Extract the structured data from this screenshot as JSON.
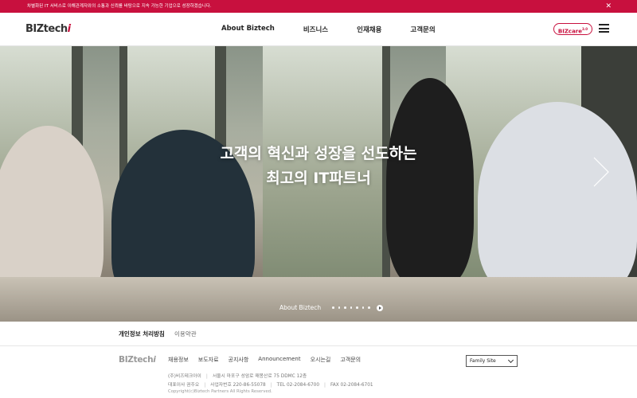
{
  "topbar": {
    "notice": "차별화된 IT 서비스로 이해관계자와의 소통과 신뢰를 바탕으로 지속 가능한 기업으로 성장하겠습니다.",
    "close_label": "✕"
  },
  "header": {
    "logo_text": "BIZtech",
    "logo_accent": "i",
    "nav": [
      "About Biztech",
      "비즈니스",
      "인재채용",
      "고객문의"
    ],
    "bizcare_label": "BIZcare",
    "bizcare_version": "3.0"
  },
  "hero": {
    "title_line1": "고객의 혁신과 성장을 선도하는",
    "title_line2": "최고의 IT파트너",
    "slide_label": "About Biztech",
    "dot_count": 7
  },
  "policy": {
    "privacy": "개인정보 처리방침",
    "terms": "이용약관"
  },
  "footer": {
    "logo_text": "BIZtech",
    "logo_accent": "i",
    "links": [
      "채용정보",
      "보도자료",
      "공지사항",
      "Announcement",
      "오시는길",
      "고객문의"
    ],
    "family_site": "Family Site",
    "company": "(주)비즈테크아이",
    "address": "서울시 마포구 성암로 매봉산로 75 DDMC 12층",
    "ceo": "대표이사 권주오",
    "biz_no": "사업자번호 220-86-55078",
    "tel": "TEL 02-2084-6700",
    "fax": "FAX 02-2084-6701",
    "copyright": "Copyright(c)Biztech Partners All Rights Reserved."
  },
  "colors": {
    "brand": "#c8103e"
  }
}
